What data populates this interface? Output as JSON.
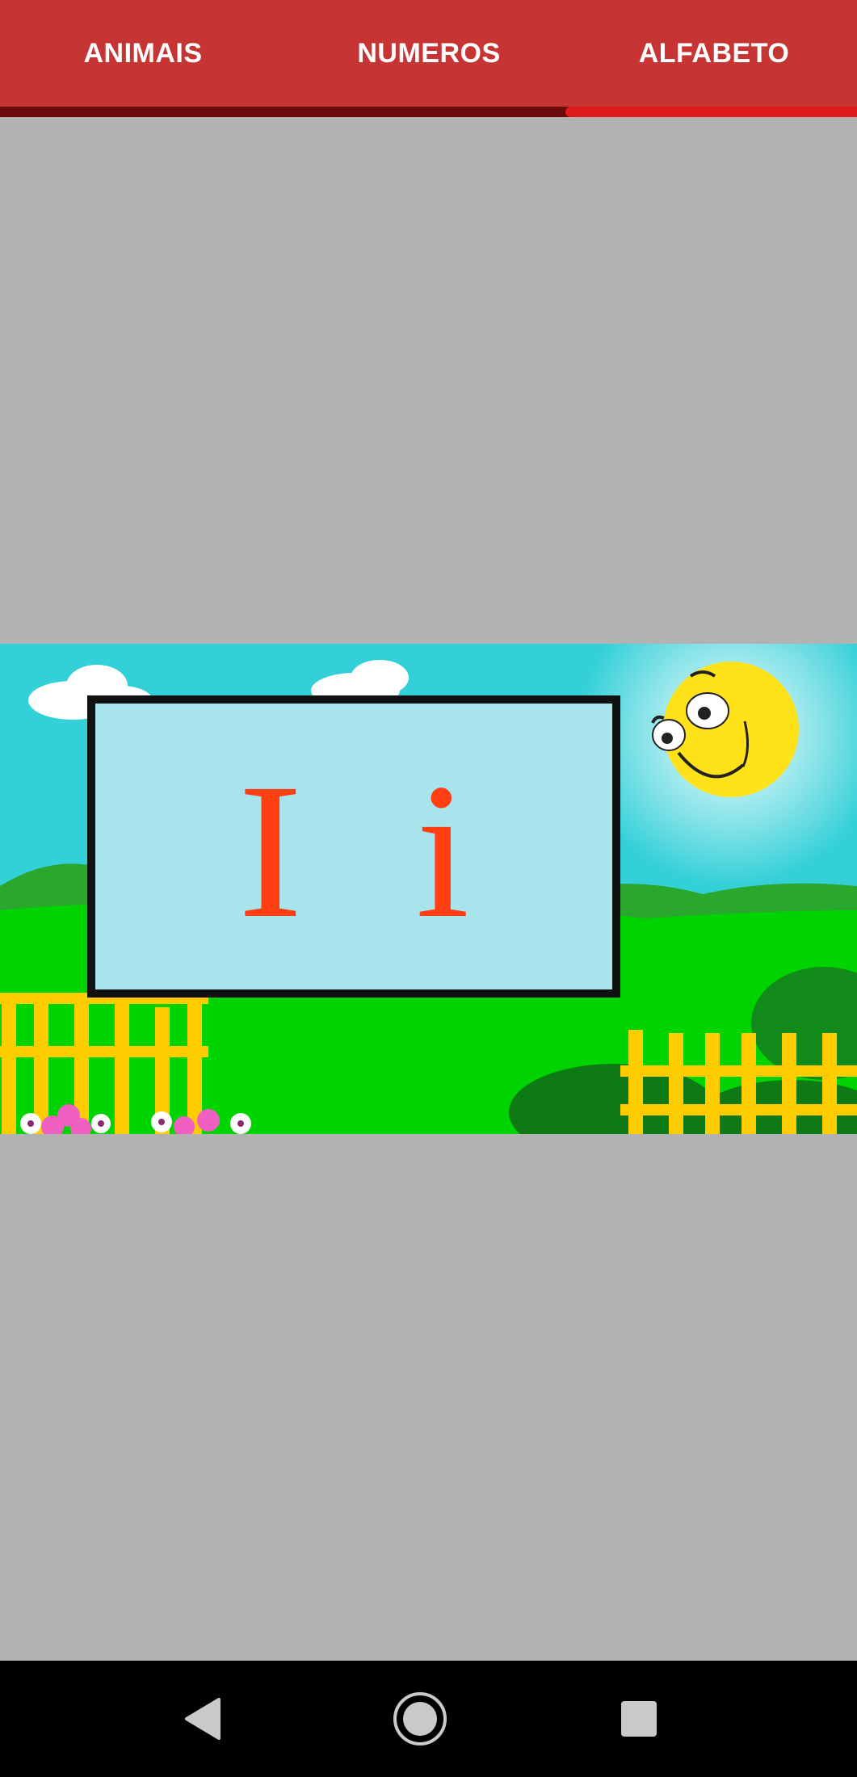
{
  "tabs": [
    {
      "label": "ANIMAIS"
    },
    {
      "label": "NUMEROS"
    },
    {
      "label": "ALFABETO",
      "selected": true
    }
  ],
  "card": {
    "letter": "I i"
  },
  "colors": {
    "tab_bar": "#c73434",
    "indicator": "#e01b1b",
    "background": "#b3b2b3",
    "letter": "#ff3f12",
    "card": "#a9e4ec"
  },
  "icons": {
    "back": "back-triangle-icon",
    "home": "home-circle-icon",
    "recents": "recents-square-icon"
  }
}
